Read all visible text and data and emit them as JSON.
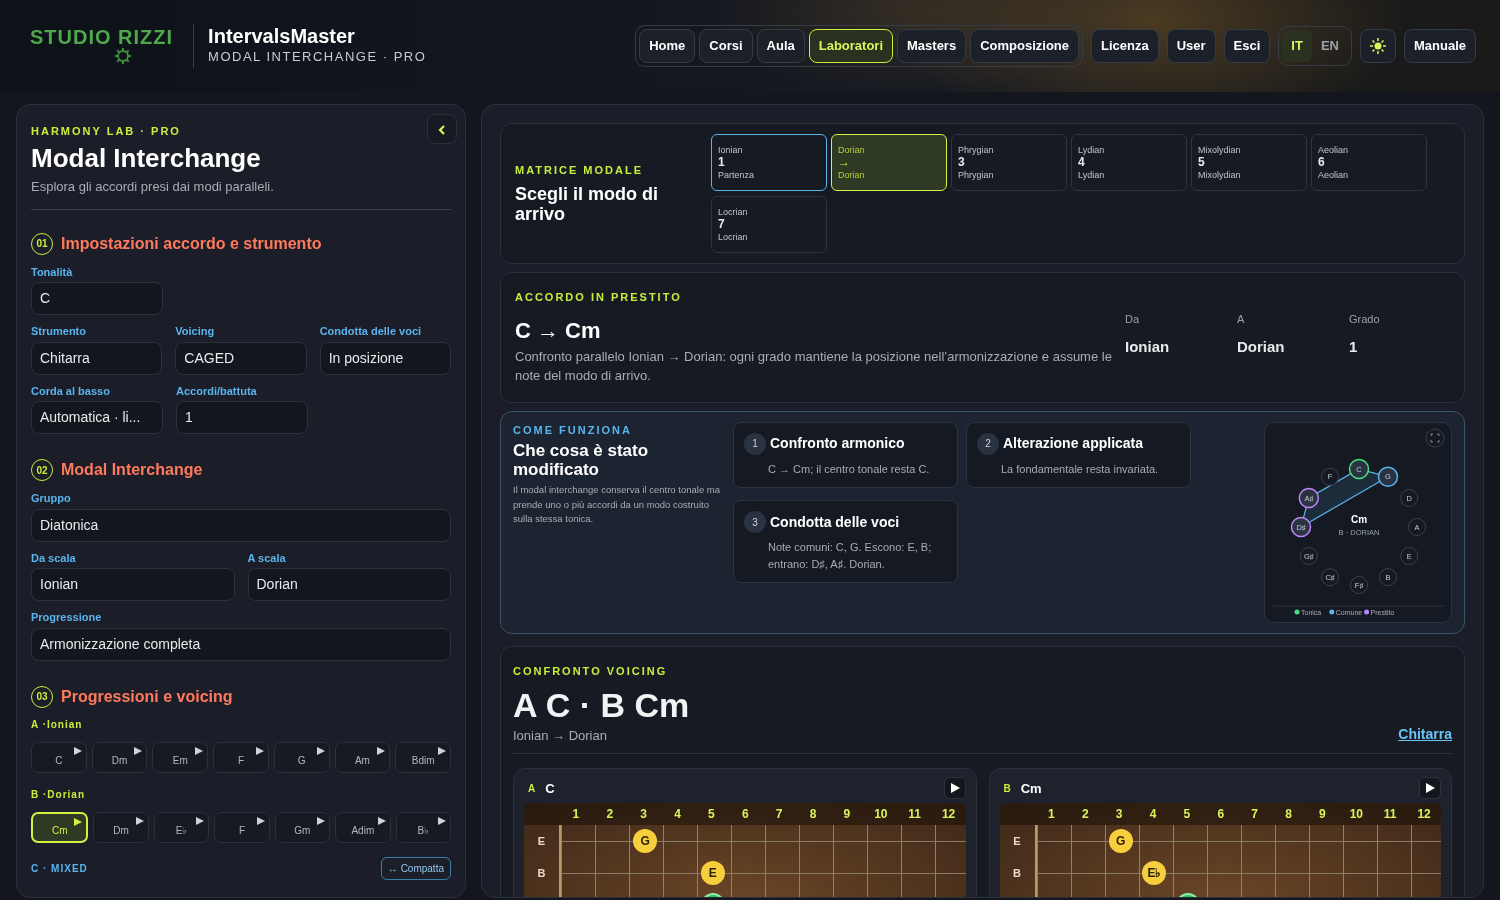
{
  "header": {
    "logo": "STUDIO RIZZI",
    "app_title": "IntervalsMaster",
    "app_subtitle": "MODAL INTERCHANGE · PRO",
    "nav": [
      {
        "label": "Home",
        "selected": false
      },
      {
        "label": "Corsi",
        "selected": false
      },
      {
        "label": "Aula",
        "selected": false
      },
      {
        "label": "Laboratori",
        "selected": true
      },
      {
        "label": "Masters",
        "selected": false
      },
      {
        "label": "Composizione",
        "selected": false
      }
    ],
    "account": [
      {
        "label": "Licenza"
      },
      {
        "label": "User"
      },
      {
        "label": "Esci"
      }
    ],
    "languages": [
      {
        "label": "IT",
        "selected": true
      },
      {
        "label": "EN",
        "selected": false
      }
    ],
    "manual": "Manuale"
  },
  "sidebar": {
    "eyebrow": "HARMONY LAB · PRO",
    "title": "Modal Interchange",
    "subtitle": "Esplora gli accordi presi dai modi paralleli.",
    "sections": [
      {
        "number": "01",
        "title": "Impostazioni accordo e strumento",
        "kind": "grid",
        "rows": [
          [
            {
              "label": "Tonalità",
              "value": "C"
            }
          ],
          [
            {
              "label": "Strumento",
              "value": "Chitarra"
            },
            {
              "label": "Voicing",
              "value": "CAGED"
            },
            {
              "label": "Condotta delle voci",
              "value": "In posizione"
            }
          ],
          [
            {
              "label": "Corda al basso",
              "value": "Automatica · li..."
            },
            {
              "label": "Accordi/battuta",
              "value": "1"
            }
          ]
        ]
      },
      {
        "number": "02",
        "title": "Modal Interchange",
        "kind": "form",
        "rows": [
          [
            {
              "label": "Gruppo",
              "value": "Diatonica"
            }
          ],
          [
            {
              "label": "Da scala",
              "value": "Ionian"
            },
            {
              "label": "A scala",
              "value": "Dorian"
            }
          ],
          [
            {
              "label": "Progressione",
              "value": "Armonizzazione completa"
            }
          ]
        ]
      },
      {
        "number": "03",
        "title": "Progressioni e voicing",
        "kind": "progressions",
        "progressions": [
          {
            "label": "A ·Ionian",
            "color": "#c8ee3c",
            "chords": [
              {
                "name": "C",
                "selected": false
              },
              {
                "name": "Dm",
                "selected": false
              },
              {
                "name": "Em",
                "selected": false
              },
              {
                "name": "F",
                "selected": false
              },
              {
                "name": "G",
                "selected": false
              },
              {
                "name": "Am",
                "selected": false
              },
              {
                "name": "Bdim",
                "selected": false
              }
            ]
          },
          {
            "label": "B ·Dorian",
            "color": "#c8ee3c",
            "chords": [
              {
                "name": "Cm",
                "selected": true
              },
              {
                "name": "Dm",
                "selected": false
              },
              {
                "name": "E♭",
                "selected": false
              },
              {
                "name": "F",
                "selected": false
              },
              {
                "name": "Gm",
                "selected": false
              },
              {
                "name": "Adim",
                "selected": false
              },
              {
                "name": "B♭",
                "selected": false
              }
            ]
          },
          {
            "label": "C · MIXED",
            "color": "#5ab4ee",
            "action": "↔ Compatta"
          }
        ]
      }
    ]
  },
  "matrix": {
    "eyebrow": "MATRICE MODALE",
    "title": "Scegli il modo di arrivo",
    "modes": [
      {
        "name": "Ionian",
        "number": "1",
        "caption": "Partenza",
        "origin": true,
        "selected": false
      },
      {
        "name": "Dorian",
        "number": "→",
        "caption": "Dorian",
        "origin": false,
        "selected": true
      },
      {
        "name": "Phrygian",
        "number": "3",
        "caption": "Phrygian",
        "origin": false,
        "selected": false
      },
      {
        "name": "Lydian",
        "number": "4",
        "caption": "Lydian",
        "origin": false,
        "selected": false
      },
      {
        "name": "Mixolydian",
        "number": "5",
        "caption": "Mixolydian",
        "origin": false,
        "selected": false
      },
      {
        "name": "Aeolian",
        "number": "6",
        "caption": "Aeolian",
        "origin": false,
        "selected": false
      },
      {
        "name": "Locrian",
        "number": "7",
        "caption": "Locrian",
        "origin": false,
        "selected": false
      }
    ]
  },
  "borrowed": {
    "eyebrow": "ACCORDO IN PRESTITO",
    "title": "C → Cm",
    "description": "Confronto parallelo Ionian → Dorian: ogni grado mantiene la posizione nell’armonizzazione e assume le note del modo di arrivo.",
    "stats": [
      {
        "label": "Da",
        "value": "Ionian"
      },
      {
        "label": "A",
        "value": "Dorian"
      },
      {
        "label": "Grado",
        "value": "1"
      }
    ]
  },
  "how": {
    "eyebrow": "COME FUNZIONA",
    "title": "Che cosa è stato modificato",
    "description": "Il modal interchange conserva il centro tonale ma prende uno o più accordi da un modo costruito sulla stessa tonica.",
    "steps": [
      {
        "number": "1",
        "title": "Confronto armonico",
        "text": "C → Cm; il centro tonale resta C."
      },
      {
        "number": "2",
        "title": "Alterazione applicata",
        "text": "La fondamentale resta invariata."
      },
      {
        "number": "3",
        "title": "Condotta delle voci",
        "text": "Note comuni: C, G. Escono: E, B; entrano: D♯, A♯. Dorian."
      }
    ],
    "circle": {
      "chord": "Cm",
      "caption": "B · DORIAN",
      "notes": [
        {
          "label": "C",
          "kind": "tonic"
        },
        {
          "label": "G",
          "kind": "common"
        },
        {
          "label": "D",
          "kind": "plain"
        },
        {
          "label": "A",
          "kind": "plain"
        },
        {
          "label": "E",
          "kind": "plain"
        },
        {
          "label": "B",
          "kind": "plain"
        },
        {
          "label": "F♯",
          "kind": "plain"
        },
        {
          "label": "C♯",
          "kind": "plain"
        },
        {
          "label": "G♯",
          "kind": "plain"
        },
        {
          "label": "D♯",
          "kind": "borrowed"
        },
        {
          "label": "A♯",
          "kind": "borrowed"
        },
        {
          "label": "F",
          "kind": "plain"
        }
      ],
      "legend": [
        {
          "label": "Tonica",
          "color": "#4ade80"
        },
        {
          "label": "Comune",
          "color": "#5ab4ee"
        },
        {
          "label": "Prestito",
          "color": "#c084fc"
        }
      ]
    }
  },
  "voicing": {
    "eyebrow": "CONFRONTO VOICING",
    "title": "A C · B Cm",
    "subtitle": "Ionian → Dorian",
    "instrument": "Chitarra",
    "boards": [
      {
        "letter": "A",
        "chord": "C",
        "frets": [
          "1",
          "2",
          "3",
          "4",
          "5",
          "6",
          "7",
          "8",
          "9",
          "10",
          "11",
          "12"
        ],
        "strings": [
          {
            "name": "E",
            "cells": [
              {
                "kind": "empty"
              },
              {
                "kind": "empty"
              },
              {
                "kind": "chord",
                "label": "G"
              },
              {
                "kind": "empty"
              },
              {
                "kind": "empty"
              },
              {
                "kind": "empty"
              },
              {
                "kind": "empty"
              },
              {
                "kind": "empty"
              },
              {
                "kind": "empty"
              },
              {
                "kind": "empty"
              },
              {
                "kind": "empty"
              },
              {
                "kind": "empty"
              }
            ]
          },
          {
            "name": "B",
            "cells": [
              {
                "kind": "empty"
              },
              {
                "kind": "empty"
              },
              {
                "kind": "empty"
              },
              {
                "kind": "empty"
              },
              {
                "kind": "chord",
                "label": "E"
              },
              {
                "kind": "empty"
              },
              {
                "kind": "empty"
              },
              {
                "kind": "empty"
              },
              {
                "kind": "empty"
              },
              {
                "kind": "empty"
              },
              {
                "kind": "empty"
              },
              {
                "kind": "empty"
              }
            ]
          },
          {
            "cells": [
              {
                "kind": "empty"
              },
              {
                "kind": "empty"
              },
              {
                "kind": "empty"
              },
              {
                "kind": "empty"
              },
              {
                "kind": "root"
              },
              {
                "kind": "empty"
              },
              {
                "kind": "empty"
              },
              {
                "kind": "empty"
              },
              {
                "kind": "empty"
              },
              {
                "kind": "empty"
              },
              {
                "kind": "empty"
              },
              {
                "kind": "empty"
              }
            ]
          }
        ]
      },
      {
        "letter": "B",
        "chord": "Cm",
        "frets": [
          "1",
          "2",
          "3",
          "4",
          "5",
          "6",
          "7",
          "8",
          "9",
          "10",
          "11",
          "12"
        ],
        "strings": [
          {
            "name": "E",
            "cells": [
              {
                "kind": "empty"
              },
              {
                "kind": "empty"
              },
              {
                "kind": "chord",
                "label": "G"
              },
              {
                "kind": "empty"
              },
              {
                "kind": "empty"
              },
              {
                "kind": "empty"
              },
              {
                "kind": "empty"
              },
              {
                "kind": "empty"
              },
              {
                "kind": "empty"
              },
              {
                "kind": "empty"
              },
              {
                "kind": "empty"
              },
              {
                "kind": "empty"
              }
            ]
          },
          {
            "name": "B",
            "cells": [
              {
                "kind": "empty"
              },
              {
                "kind": "empty"
              },
              {
                "kind": "empty"
              },
              {
                "kind": "chord",
                "label": "E♭"
              },
              {
                "kind": "empty"
              },
              {
                "kind": "empty"
              },
              {
                "kind": "empty"
              },
              {
                "kind": "empty"
              },
              {
                "kind": "empty"
              },
              {
                "kind": "empty"
              },
              {
                "kind": "empty"
              },
              {
                "kind": "empty"
              }
            ]
          },
          {
            "cells": [
              {
                "kind": "empty"
              },
              {
                "kind": "empty"
              },
              {
                "kind": "empty"
              },
              {
                "kind": "empty"
              },
              {
                "kind": "root"
              },
              {
                "kind": "empty"
              },
              {
                "kind": "empty"
              },
              {
                "kind": "empty"
              },
              {
                "kind": "empty"
              },
              {
                "kind": "empty"
              },
              {
                "kind": "empty"
              },
              {
                "kind": "empty"
              }
            ]
          }
        ]
      }
    ]
  }
}
